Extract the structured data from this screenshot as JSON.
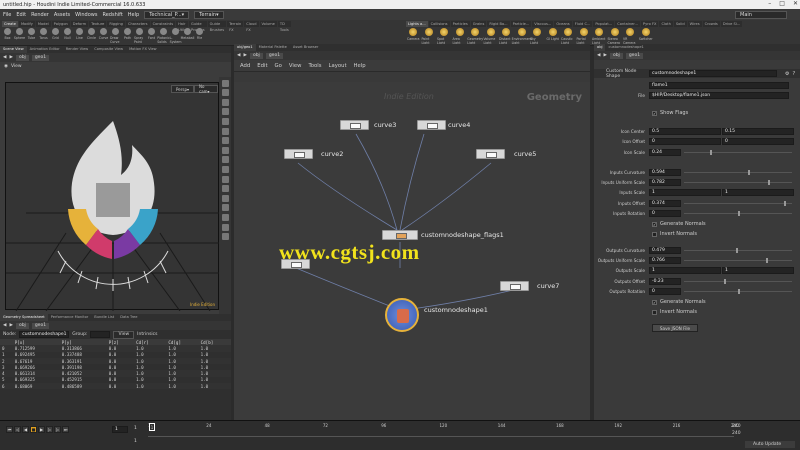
{
  "title": "untitled.hip - Houdini Indie Limited-Commercial 16.0.633",
  "menu": [
    "File",
    "Edit",
    "Render",
    "Assets",
    "Windows",
    "Redshift",
    "Help"
  ],
  "desktop": "Technical_P...",
  "context": "Terrain",
  "main_desk": "Main",
  "shelf_tabs_left": [
    "Create",
    "Modify",
    "Model",
    "Polygon",
    "Deform",
    "Texture",
    "Rigging",
    "Characters",
    "Constraints",
    "Hair Utils",
    "Guide Process",
    "Guide Brushes",
    "Terrain FX",
    "Cloud FX",
    "Volume",
    "TD Tools"
  ],
  "shelf_tools_left": [
    "Box",
    "Sphere",
    "Tube",
    "Torus",
    "Grid",
    "Null",
    "Line",
    "Circle",
    "Curve",
    "Draw Curve",
    "Path",
    "Spray Paint",
    "Font",
    "Platonic Solids",
    "L-System",
    "Metaball",
    "File"
  ],
  "shelf_tabs_right": [
    "Lights a...",
    "Collisions",
    "Particles",
    "Grains",
    "Rigid Bo...",
    "Particle...",
    "Viscous...",
    "Oceans",
    "Fluid C...",
    "Populat...",
    "Container...",
    "Pyro FX",
    "Cloth",
    "Solid",
    "Wires",
    "Crowds",
    "Drive Si..."
  ],
  "shelf_tools_right": [
    "Camera",
    "Point Light",
    "Spot Light",
    "Area Light",
    "Geometry Light",
    "Volume Light",
    "Distant Light",
    "Environment Light",
    "Sky Light",
    "GI Light",
    "Caustic Light",
    "Portal Light",
    "Ambient Light",
    "Stereo Camera",
    "VR Camera",
    "Switcher"
  ],
  "left_tabs": [
    "Scene View",
    "Animation Editor",
    "Render View",
    "Composite View",
    "Motion FX View"
  ],
  "left_path": [
    "obj",
    "geo1"
  ],
  "view_label": "View",
  "persp": "Persp▾",
  "cam": "No cam▾",
  "indie_edition": "Indie Edition",
  "spread_tabs": [
    "Geometry Spreadsheet",
    "Performance Monitor",
    "Bundle List",
    "Data Tree"
  ],
  "spread_node_label": "Node:",
  "spread_node": "customnodeshape1",
  "spread_group": "Group:",
  "spread_view": "View",
  "spread_attrs": "Intrinsics",
  "spread_cols": [
    "",
    "P[x]",
    "P[y]",
    "P[z]",
    "Cd[r]",
    "Cd[g]",
    "Cd[b]"
  ],
  "spread_rows": [
    [
      "0",
      "0.712599",
      "0.313866",
      "0.0",
      "1.0",
      "1.0",
      "1.0"
    ],
    [
      "1",
      "0.692495",
      "0.337488",
      "0.0",
      "1.0",
      "1.0",
      "1.0"
    ],
    [
      "2",
      "0.67619",
      "0.363191",
      "0.0",
      "1.0",
      "1.0",
      "1.0"
    ],
    [
      "3",
      "0.669266",
      "0.391198",
      "0.0",
      "1.0",
      "1.0",
      "1.0"
    ],
    [
      "4",
      "0.661314",
      "0.421052",
      "0.0",
      "1.0",
      "1.0",
      "1.0"
    ],
    [
      "5",
      "0.669325",
      "0.452915",
      "0.0",
      "1.0",
      "1.0",
      "1.0"
    ],
    [
      "6",
      "0.68069",
      "0.486589",
      "0.0",
      "1.0",
      "1.0",
      "1.0"
    ]
  ],
  "net_tabs": [
    "obj/geo1",
    "Material Palette",
    "Asset Browser"
  ],
  "net_path": [
    "obj",
    "geo1"
  ],
  "net_menu": [
    "Add",
    "Edit",
    "Go",
    "View",
    "Tools",
    "Layout",
    "Help"
  ],
  "net_watermark": "Indie Edition",
  "net_context": "Geometry",
  "nodes": {
    "curve3": "curve3",
    "curve4": "curve4",
    "curve2": "curve2",
    "curve5": "curve5",
    "flags": "customnodeshape_flags1",
    "curve7": "curve7",
    "custom": "customnodeshape1"
  },
  "watermark": "www.cgtsj.com",
  "parm_tabs": [
    "obj",
    "customnodeshape1"
  ],
  "parm_path": [
    "obj",
    "geo1"
  ],
  "parm_type": "Custom Node Shape",
  "parm_node": "customnodeshape1",
  "parm_name": "flame1",
  "parm_file_label": "File",
  "parm_file": "$HIP/Desktop/flame1.json",
  "show_flags": "Show Flags",
  "icon_center_label": "Icon Center",
  "icon_center": [
    "0.5",
    "0.15"
  ],
  "icon_offset_label": "Icon Offset",
  "icon_offset": [
    "0",
    "0"
  ],
  "icon_scale_label": "Icon Scale",
  "icon_scale": "0.24",
  "in_curv_label": "Inputs Curvature",
  "in_curv": "0.594",
  "in_uscale_label": "Inputs Uniform Scale",
  "in_uscale": "0.782",
  "in_scale_label": "Inputs Scale",
  "in_scale": [
    "1",
    "1"
  ],
  "in_offset_label": "Inputs Offset",
  "in_offset": "0.374",
  "in_rot_label": "Inputs Rotation",
  "in_rot": "0",
  "gen_normals": "Generate Normals",
  "inv_normals": "Invert Normals",
  "out_curv_label": "Outputs Curvature",
  "out_curv": "0.479",
  "out_uscale_label": "Outputs Uniform Scale",
  "out_uscale": "0.766",
  "out_scale_label": "Outputs Scale",
  "out_scale": [
    "1",
    "1"
  ],
  "out_offset_label": "Outputs Offset",
  "out_offset": "-0.23",
  "out_rot_label": "Outputs Rotation",
  "out_rot": "0",
  "save_json": "Save JSON File",
  "frame": "1",
  "start": "1",
  "start2": "1",
  "end": "240",
  "end2": "240",
  "ticks": [
    "1",
    "24",
    "48",
    "72",
    "96",
    "120",
    "144",
    "168",
    "192",
    "216",
    "240"
  ],
  "auto_update": "Auto Update",
  "accent_orange": "#e6b23a",
  "accent_flame": "#dcdcdc"
}
